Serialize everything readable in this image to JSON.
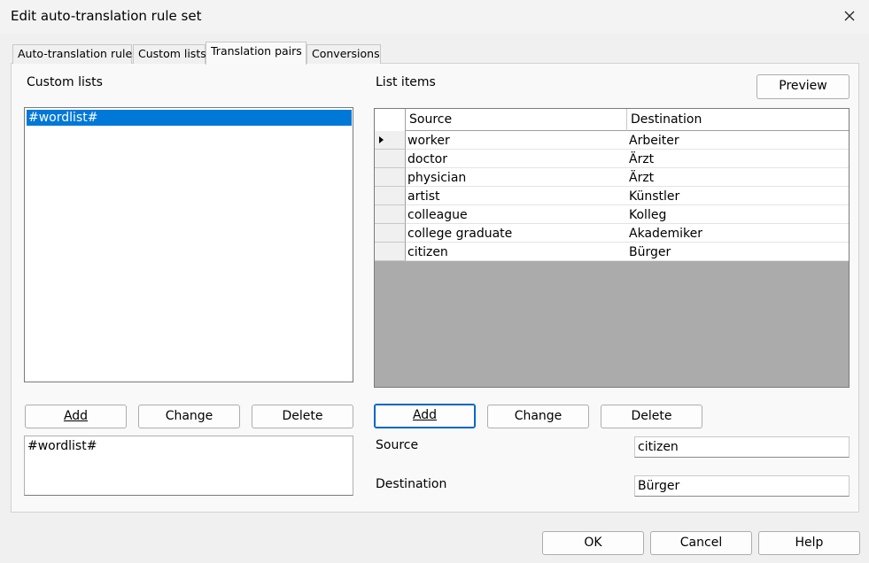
{
  "window": {
    "title": "Edit auto-translation rule set"
  },
  "tabs": [
    {
      "label": "Auto-translation rules"
    },
    {
      "label": "Custom lists"
    },
    {
      "label": "Translation pairs"
    },
    {
      "label": "Conversions"
    }
  ],
  "custom_lists": {
    "label": "Custom lists",
    "items": [
      "#wordlist#"
    ],
    "add_label": "Add",
    "change_label": "Change",
    "delete_label": "Delete",
    "edit_value": "#wordlist#"
  },
  "list_items": {
    "label": "List items",
    "preview_label": "Preview",
    "columns": [
      "Source",
      "Destination"
    ],
    "rows": [
      {
        "source": "worker",
        "destination": "Arbeiter"
      },
      {
        "source": "doctor",
        "destination": "Ärzt"
      },
      {
        "source": "physician",
        "destination": "Ärzt"
      },
      {
        "source": "artist",
        "destination": "Künstler"
      },
      {
        "source": "colleague",
        "destination": "Kolleg"
      },
      {
        "source": "college graduate",
        "destination": "Akademiker"
      },
      {
        "source": "citizen",
        "destination": "Bürger"
      }
    ],
    "add_label": "Add",
    "change_label": "Change",
    "delete_label": "Delete",
    "source_label": "Source",
    "source_value": "citizen",
    "destination_label": "Destination",
    "destination_value": "Bürger"
  },
  "footer": {
    "ok_label": "OK",
    "cancel_label": "Cancel",
    "help_label": "Help"
  }
}
